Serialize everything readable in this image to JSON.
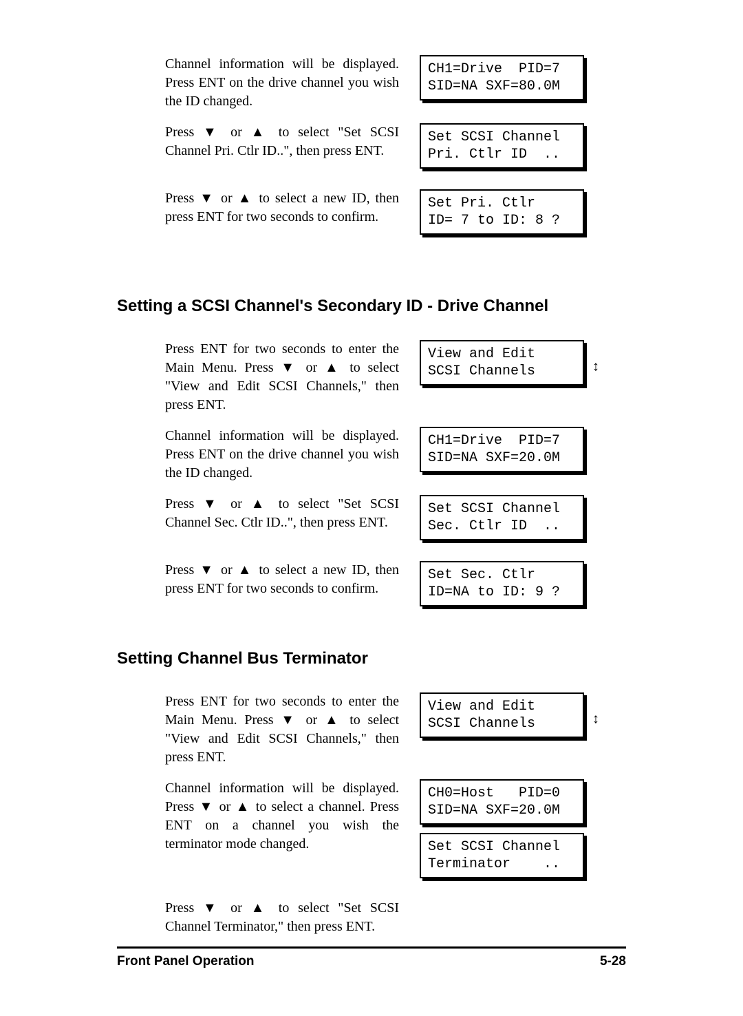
{
  "glyphs": {
    "down": "▼",
    "up": "▲",
    "updown": "↕"
  },
  "section0": {
    "p1_a": "Channel information will be displayed. Press ENT on the drive channel you wish the ID changed.",
    "lcd1": "CH1=Drive  PID=7\nSID=NA SXF=80.0M",
    "p2_a": "Press ",
    "p2_b": " or ",
    "p2_c": " to select \"Set SCSI Channel Pri. Ctlr ID..\", then press ENT.",
    "lcd2": "Set SCSI Channel\nPri. Ctlr ID  ..",
    "p3_a": "Press ",
    "p3_b": " or ",
    "p3_c": " to select a new ID, then press ENT for two seconds to confirm.",
    "lcd3": "Set Pri. Ctlr\nID= 7 to ID: 8 ?"
  },
  "heading1": "Setting a SCSI Channel's Secondary ID - Drive Channel",
  "section1": {
    "p1_a": "Press ENT for two seconds to enter the Main Menu.  Press ",
    "p1_b": " or ",
    "p1_c": " to select \"View and Edit SCSI Channels,\" then press ENT.",
    "lcd1": "View and Edit\nSCSI Channels   ",
    "p2_a": "Channel information will be displayed. Press ENT on the drive channel you wish the ID changed.",
    "lcd2": "CH1=Drive  PID=7\nSID=NA SXF=20.0M",
    "p3_a": "Press ",
    "p3_b": " or ",
    "p3_c": " to select \"Set SCSI Channel Sec. Ctlr ID..\", then press ENT.",
    "lcd3": "Set SCSI Channel\nSec. Ctlr ID  ..",
    "p4_a": "Press ",
    "p4_b": " or ",
    "p4_c": " to select a new ID, then press ENT for two seconds to confirm.",
    "lcd4": "Set Sec. Ctlr\nID=NA to ID: 9 ?"
  },
  "heading2": "Setting Channel Bus Terminator",
  "section2": {
    "p1_a": "Press ENT for two seconds to enter the Main Menu.  Press ",
    "p1_b": " or ",
    "p1_c": " to select \"View and Edit SCSI Channels,\" then press ENT.",
    "lcd1": "View and Edit\nSCSI Channels   ",
    "p2_a": "Channel information will be displayed. Press ",
    "p2_b": " or ",
    "p2_c": " to select a channel.  Press ENT on a channel you wish the terminator mode changed.",
    "lcd2": "CH0=Host   PID=0\nSID=NA SXF=20.0M",
    "p3_a": "Press ",
    "p3_b": " or ",
    "p3_c": " to select \"Set SCSI Channel Terminator,\" then press ENT.",
    "lcd3": "Set SCSI Channel\nTerminator    .."
  },
  "footer": {
    "left": "Front Panel Operation",
    "right": "5-28"
  }
}
